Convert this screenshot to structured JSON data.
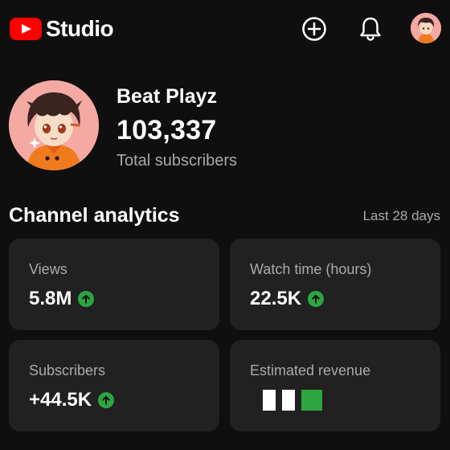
{
  "header": {
    "logo_text": "Studio",
    "create_icon": "plus-circle-icon",
    "notifications_icon": "bell-icon",
    "account_icon": "avatar"
  },
  "channel": {
    "name": "Beat Playz",
    "subscribers": "103,337",
    "subscribers_label": "Total subscribers"
  },
  "analytics": {
    "title": "Channel analytics",
    "period": "Last 28 days",
    "cards": [
      {
        "label": "Views",
        "value": "5.8M",
        "trend": "up"
      },
      {
        "label": "Watch time (hours)",
        "value": "22.5K",
        "trend": "up"
      },
      {
        "label": "Subscribers",
        "value": "+44.5K",
        "trend": "up"
      },
      {
        "label": "Estimated revenue",
        "value": ""
      }
    ]
  },
  "colors": {
    "background": "#0f0f0f",
    "card": "#212121",
    "accent_red": "#ff0000",
    "trend_green": "#2ba640",
    "secondary_text": "#aaaaaa"
  }
}
